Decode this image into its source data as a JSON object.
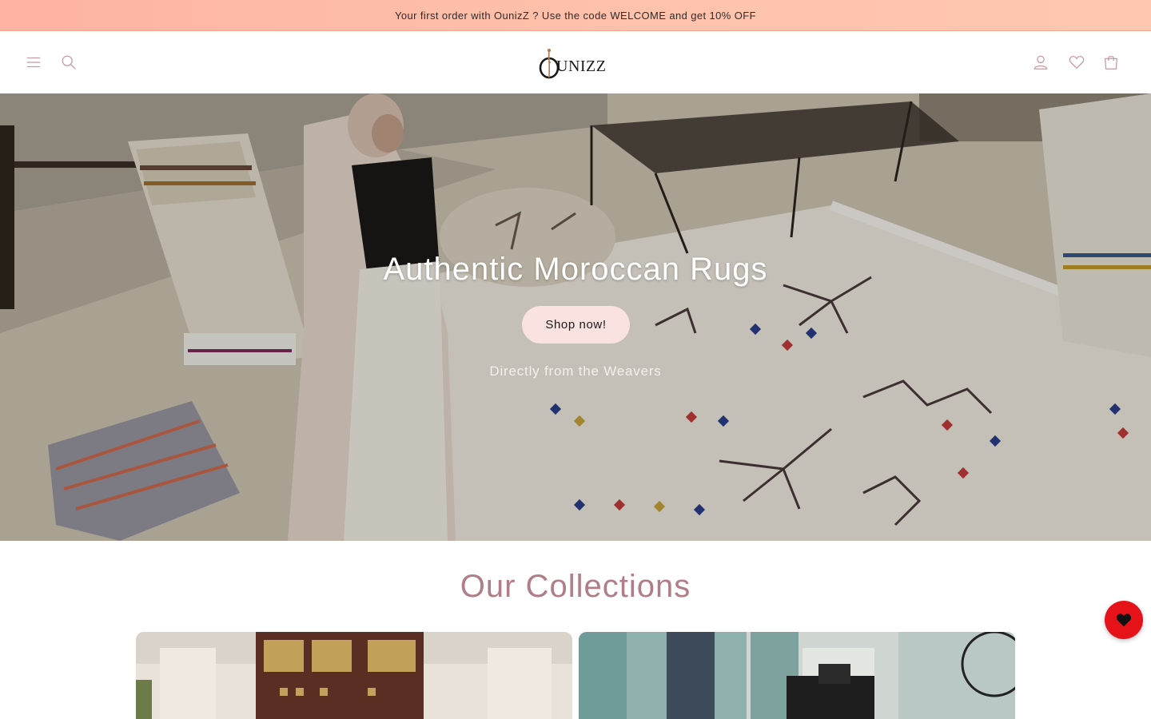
{
  "announcement": {
    "text": "Your first order with OunizZ ? Use the code WELCOME and get 10% OFF"
  },
  "header": {
    "logo_text": "UNIZZ",
    "icons": [
      "menu-icon",
      "search-icon",
      "account-icon",
      "heart-icon",
      "cart-icon"
    ]
  },
  "hero": {
    "title": "Authentic Moroccan Rugs",
    "button_label": "Shop now!",
    "subtitle": "Directly from the Weavers"
  },
  "collections": {
    "title": "Our Collections"
  },
  "floating": {
    "icon": "heart-icon"
  },
  "colors": {
    "announcement_bg": "#ffc3ad",
    "accent_pink": "#c89aa3",
    "collections_title": "#b07e86",
    "hero_button_bg": "#f9e2e0",
    "floating_button": "#e6121a"
  }
}
